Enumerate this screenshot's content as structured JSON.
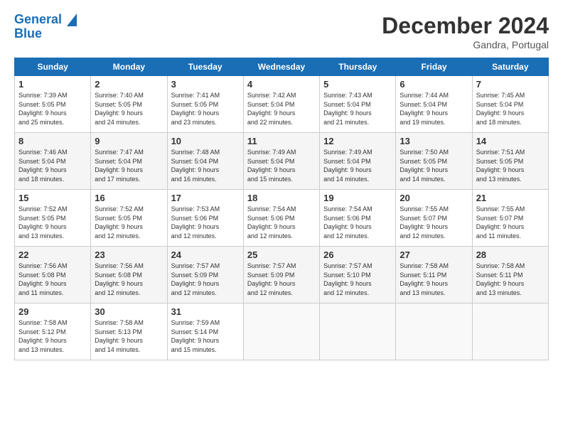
{
  "header": {
    "logo_line1": "General",
    "logo_line2": "Blue",
    "month": "December 2024",
    "location": "Gandra, Portugal"
  },
  "days_of_week": [
    "Sunday",
    "Monday",
    "Tuesday",
    "Wednesday",
    "Thursday",
    "Friday",
    "Saturday"
  ],
  "weeks": [
    [
      {
        "num": "1",
        "info": "Sunrise: 7:39 AM\nSunset: 5:05 PM\nDaylight: 9 hours\nand 25 minutes."
      },
      {
        "num": "2",
        "info": "Sunrise: 7:40 AM\nSunset: 5:05 PM\nDaylight: 9 hours\nand 24 minutes."
      },
      {
        "num": "3",
        "info": "Sunrise: 7:41 AM\nSunset: 5:05 PM\nDaylight: 9 hours\nand 23 minutes."
      },
      {
        "num": "4",
        "info": "Sunrise: 7:42 AM\nSunset: 5:04 PM\nDaylight: 9 hours\nand 22 minutes."
      },
      {
        "num": "5",
        "info": "Sunrise: 7:43 AM\nSunset: 5:04 PM\nDaylight: 9 hours\nand 21 minutes."
      },
      {
        "num": "6",
        "info": "Sunrise: 7:44 AM\nSunset: 5:04 PM\nDaylight: 9 hours\nand 19 minutes."
      },
      {
        "num": "7",
        "info": "Sunrise: 7:45 AM\nSunset: 5:04 PM\nDaylight: 9 hours\nand 18 minutes."
      }
    ],
    [
      {
        "num": "8",
        "info": "Sunrise: 7:46 AM\nSunset: 5:04 PM\nDaylight: 9 hours\nand 18 minutes."
      },
      {
        "num": "9",
        "info": "Sunrise: 7:47 AM\nSunset: 5:04 PM\nDaylight: 9 hours\nand 17 minutes."
      },
      {
        "num": "10",
        "info": "Sunrise: 7:48 AM\nSunset: 5:04 PM\nDaylight: 9 hours\nand 16 minutes."
      },
      {
        "num": "11",
        "info": "Sunrise: 7:49 AM\nSunset: 5:04 PM\nDaylight: 9 hours\nand 15 minutes."
      },
      {
        "num": "12",
        "info": "Sunrise: 7:49 AM\nSunset: 5:04 PM\nDaylight: 9 hours\nand 14 minutes."
      },
      {
        "num": "13",
        "info": "Sunrise: 7:50 AM\nSunset: 5:05 PM\nDaylight: 9 hours\nand 14 minutes."
      },
      {
        "num": "14",
        "info": "Sunrise: 7:51 AM\nSunset: 5:05 PM\nDaylight: 9 hours\nand 13 minutes."
      }
    ],
    [
      {
        "num": "15",
        "info": "Sunrise: 7:52 AM\nSunset: 5:05 PM\nDaylight: 9 hours\nand 13 minutes."
      },
      {
        "num": "16",
        "info": "Sunrise: 7:52 AM\nSunset: 5:05 PM\nDaylight: 9 hours\nand 12 minutes."
      },
      {
        "num": "17",
        "info": "Sunrise: 7:53 AM\nSunset: 5:06 PM\nDaylight: 9 hours\nand 12 minutes."
      },
      {
        "num": "18",
        "info": "Sunrise: 7:54 AM\nSunset: 5:06 PM\nDaylight: 9 hours\nand 12 minutes."
      },
      {
        "num": "19",
        "info": "Sunrise: 7:54 AM\nSunset: 5:06 PM\nDaylight: 9 hours\nand 12 minutes."
      },
      {
        "num": "20",
        "info": "Sunrise: 7:55 AM\nSunset: 5:07 PM\nDaylight: 9 hours\nand 12 minutes."
      },
      {
        "num": "21",
        "info": "Sunrise: 7:55 AM\nSunset: 5:07 PM\nDaylight: 9 hours\nand 11 minutes."
      }
    ],
    [
      {
        "num": "22",
        "info": "Sunrise: 7:56 AM\nSunset: 5:08 PM\nDaylight: 9 hours\nand 11 minutes."
      },
      {
        "num": "23",
        "info": "Sunrise: 7:56 AM\nSunset: 5:08 PM\nDaylight: 9 hours\nand 12 minutes."
      },
      {
        "num": "24",
        "info": "Sunrise: 7:57 AM\nSunset: 5:09 PM\nDaylight: 9 hours\nand 12 minutes."
      },
      {
        "num": "25",
        "info": "Sunrise: 7:57 AM\nSunset: 5:09 PM\nDaylight: 9 hours\nand 12 minutes."
      },
      {
        "num": "26",
        "info": "Sunrise: 7:57 AM\nSunset: 5:10 PM\nDaylight: 9 hours\nand 12 minutes."
      },
      {
        "num": "27",
        "info": "Sunrise: 7:58 AM\nSunset: 5:11 PM\nDaylight: 9 hours\nand 13 minutes."
      },
      {
        "num": "28",
        "info": "Sunrise: 7:58 AM\nSunset: 5:11 PM\nDaylight: 9 hours\nand 13 minutes."
      }
    ],
    [
      {
        "num": "29",
        "info": "Sunrise: 7:58 AM\nSunset: 5:12 PM\nDaylight: 9 hours\nand 13 minutes."
      },
      {
        "num": "30",
        "info": "Sunrise: 7:58 AM\nSunset: 5:13 PM\nDaylight: 9 hours\nand 14 minutes."
      },
      {
        "num": "31",
        "info": "Sunrise: 7:59 AM\nSunset: 5:14 PM\nDaylight: 9 hours\nand 15 minutes."
      },
      {
        "num": "",
        "info": ""
      },
      {
        "num": "",
        "info": ""
      },
      {
        "num": "",
        "info": ""
      },
      {
        "num": "",
        "info": ""
      }
    ]
  ]
}
